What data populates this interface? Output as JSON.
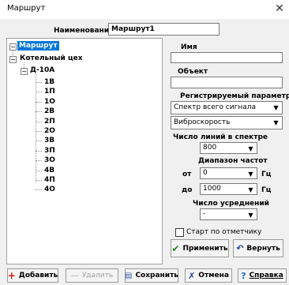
{
  "window": {
    "title": "Маршрут",
    "close_glyph": "✕"
  },
  "name_row": {
    "label": "Наименование",
    "value": "Маршрут1"
  },
  "tree": {
    "root": "Маршрут",
    "group": "Котельный цех",
    "unit": "Д-10А",
    "points": [
      "1В",
      "1П",
      "1О",
      "2В",
      "2П",
      "2О",
      "3В",
      "3П",
      "3О",
      "4В",
      "4П",
      "4О"
    ]
  },
  "props": {
    "name_label": "Имя",
    "name_value": "",
    "object_label": "Объект",
    "object_value": "",
    "param_label": "Регистрируемый параметр",
    "param_value": "Спектр всего сигнала",
    "unit_value": "Виброскорость",
    "lines_label": "Число линий в спектре",
    "lines_value": "800",
    "range_label": "Диапазон частот",
    "from_label": "от",
    "from_value": "0",
    "to_label": "до",
    "to_value": "1000",
    "hz": "Гц",
    "avg_label": "Число усреднений",
    "avg_value": "-",
    "start_label": "Старт по отметчику",
    "start_checked": false
  },
  "buttons": {
    "apply": "Применить",
    "revert": "Вернуть",
    "add": "Добавить",
    "delete": "Удалить",
    "save": "Сохранить",
    "cancel": "Отмена",
    "help": "Справка"
  }
}
